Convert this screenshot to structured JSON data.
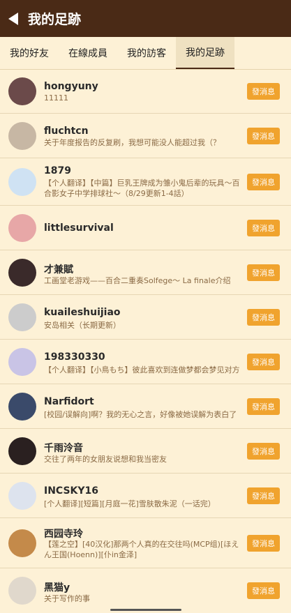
{
  "header": {
    "title": "我的足跡"
  },
  "tabs": [
    "我的好友",
    "在線成員",
    "我的訪客",
    "我的足跡"
  ],
  "button_label": "發消息",
  "users": [
    {
      "name": "hongyuny",
      "desc": "11111",
      "color": "#6b4a4a"
    },
    {
      "name": "fluchtcn",
      "desc": "关于年度报告的反复刷，我想可能没人能超过我（？",
      "color": "#c7b7a4"
    },
    {
      "name": "1879",
      "desc": "【个人翻译】【中篇】巨乳王牌成为雏小鬼后辈的玩具～百合影女子中学排球社～（8/29更新1-4話）",
      "color": "#cfe2f3"
    },
    {
      "name": "littlesurvival",
      "desc": "",
      "color": "#e7a7a7"
    },
    {
      "name": "才兼賦",
      "desc": "工画堂老游戏——百合二重奏Solfege～ La finale介绍",
      "color": "#3a2a2a"
    },
    {
      "name": "kuaileshuijiao",
      "desc": "安岛相关（长期更新）",
      "color": "#cccccc"
    },
    {
      "name": "198330330",
      "desc": "【个人翻译】【小鳥もち】彼此喜欢到连做梦都会梦见对方",
      "color": "#c9c4e6"
    },
    {
      "name": "Narfidort",
      "desc": "[校园/误解向]啊？我的无心之言，好像被她误解为表白了",
      "color": "#3a4a6a"
    },
    {
      "name": "千雨泠音",
      "desc": "交往了两年的女朋友说想和我当密友",
      "color": "#2a2020"
    },
    {
      "name": "INCSKY16",
      "desc": "[个人翻译][短篇][月庭一花]雪肤散朱泥（一话完）",
      "color": "#dde3ee"
    },
    {
      "name": "西园寺玲",
      "desc": "【莲之空】[40汉化]那两个人真的在交往吗(MCP组)[ほえん王国(Hoenn)][仆in金泽]",
      "color": "#c48a4a"
    },
    {
      "name": "黑猫y",
      "desc": "关于写作的事",
      "color": "#e0d8cc"
    }
  ]
}
